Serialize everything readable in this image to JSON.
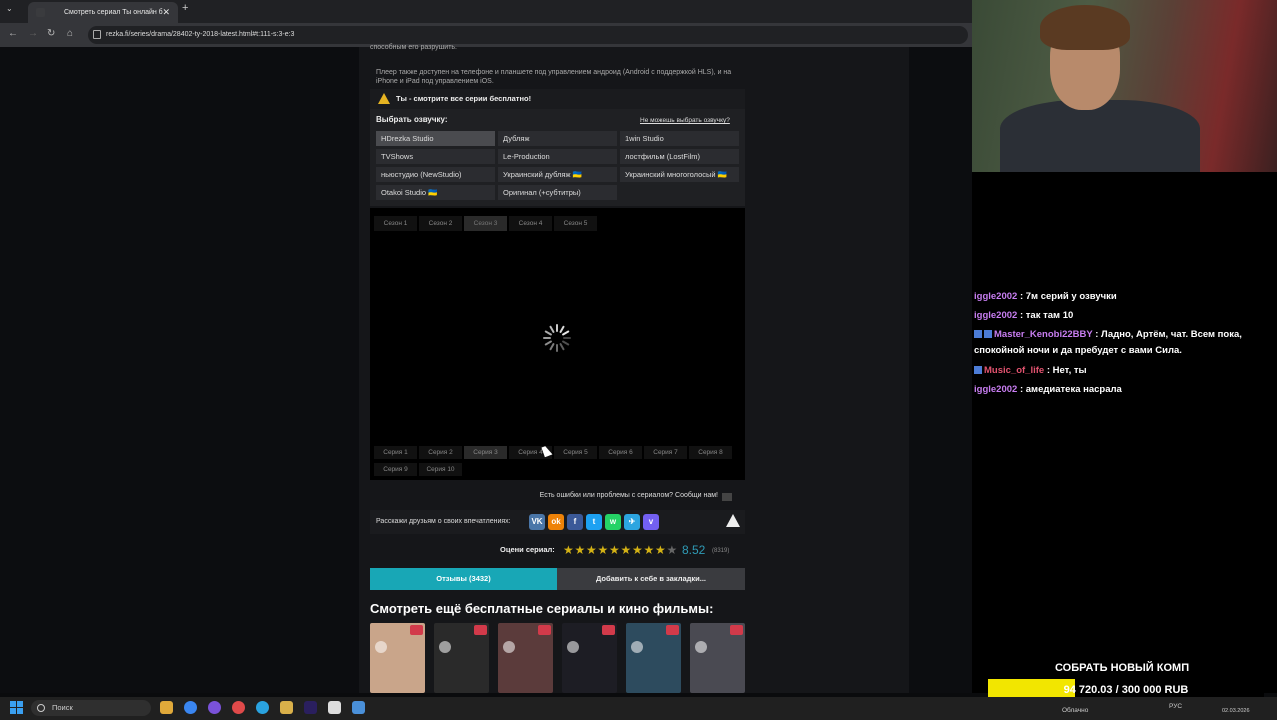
{
  "browser": {
    "tab_title": "Смотреть сериал Ты онлайн б",
    "url": "rezka.fi/series/drama/28402-ty-2018-latest.html#t:111-s:3-e:3",
    "new_tab": "+",
    "close": "✕"
  },
  "page": {
    "top_text": "способным его разрушить.",
    "desc": "Плеер также доступен на телефоне и планшете под управлением андроид (Android с поддержкой HLS), и на iPhone и iPad под управлением iOS.",
    "notice": "Ты - смотрите все серии бесплатно!",
    "voice_label": "Выбрать озвучку:",
    "voice_link": "Не можешь выбрать озвучку?",
    "voices": [
      "HDrezka Studio",
      "Дубляж",
      "1win Studio",
      "TVShows",
      "Le-Production",
      "лостфильм (LostFilm)",
      "ньюстудио (NewStudio)",
      "Украинский дубляж 🇺🇦",
      "Украинский многоголосый 🇺🇦",
      "Otakoi Studio 🇺🇦",
      "Оригинал (+субтитры)"
    ],
    "seasons": [
      "Сезон 1",
      "Сезон 2",
      "Сезон 3",
      "Сезон 4",
      "Сезон 5"
    ],
    "episodes": [
      "Серия 1",
      "Серия 2",
      "Серия 3",
      "Серия 4",
      "Серия 5",
      "Серия 6",
      "Серия 7",
      "Серия 8",
      "Серия 9",
      "Серия 10"
    ],
    "error_text": "Есть ошибки или проблемы с сериалом? Сообщи нам!",
    "share_text": "Расскажи друзьям о своих впечатлениях:",
    "share_icons": [
      "vk-icon",
      "ok-icon",
      "facebook-icon",
      "twitter-icon",
      "whatsapp-icon",
      "telegram-icon",
      "viber-icon"
    ],
    "rate_label": "Оцени сериал:",
    "rating": "8.52",
    "rating_count": "(8319)",
    "stars_filled": 9.5,
    "reviews_btn": "Отзывы (3432)",
    "bookmark_btn": "Добавить к себе в закладки...",
    "more_title": "Смотреть ещё бесплатные сериалы и кино фильмы:",
    "thumb_colors": [
      "#c9a58a",
      "#2a2a2a",
      "#5b3b3b",
      "#1d1d24",
      "#2d4b5e",
      "#4a4a52"
    ]
  },
  "chat": {
    "messages": [
      {
        "user": "iggle2002",
        "text": ": 7м серий у озвучки",
        "color": "#c77df0",
        "badges": 0
      },
      {
        "user": "iggle2002",
        "text": ": так там 10",
        "color": "#c77df0",
        "badges": 0
      },
      {
        "user": "Master_Kenobi22BBY",
        "text": ": Ладно, Артём, чат. Всем пока, спокойной ночи и да пребудет с вами Сила.",
        "color": "#c77df0",
        "badges": 2
      },
      {
        "user": "Music_of_life",
        "text": ": Нет, ты",
        "color": "#e2536f",
        "badges": 1
      },
      {
        "user": "iggle2002",
        "text": ": амедиатека насрала",
        "color": "#c77df0",
        "badges": 0
      }
    ]
  },
  "donation": {
    "title": "СОБРАТЬ НОВЫЙ КОМП",
    "text": "94 720.03 / 300 000 RUB",
    "progress": 0.316
  },
  "taskbar": {
    "search": "Поиск",
    "weather": "Облачно",
    "lang": "РУС",
    "date": "02.03.2026"
  }
}
